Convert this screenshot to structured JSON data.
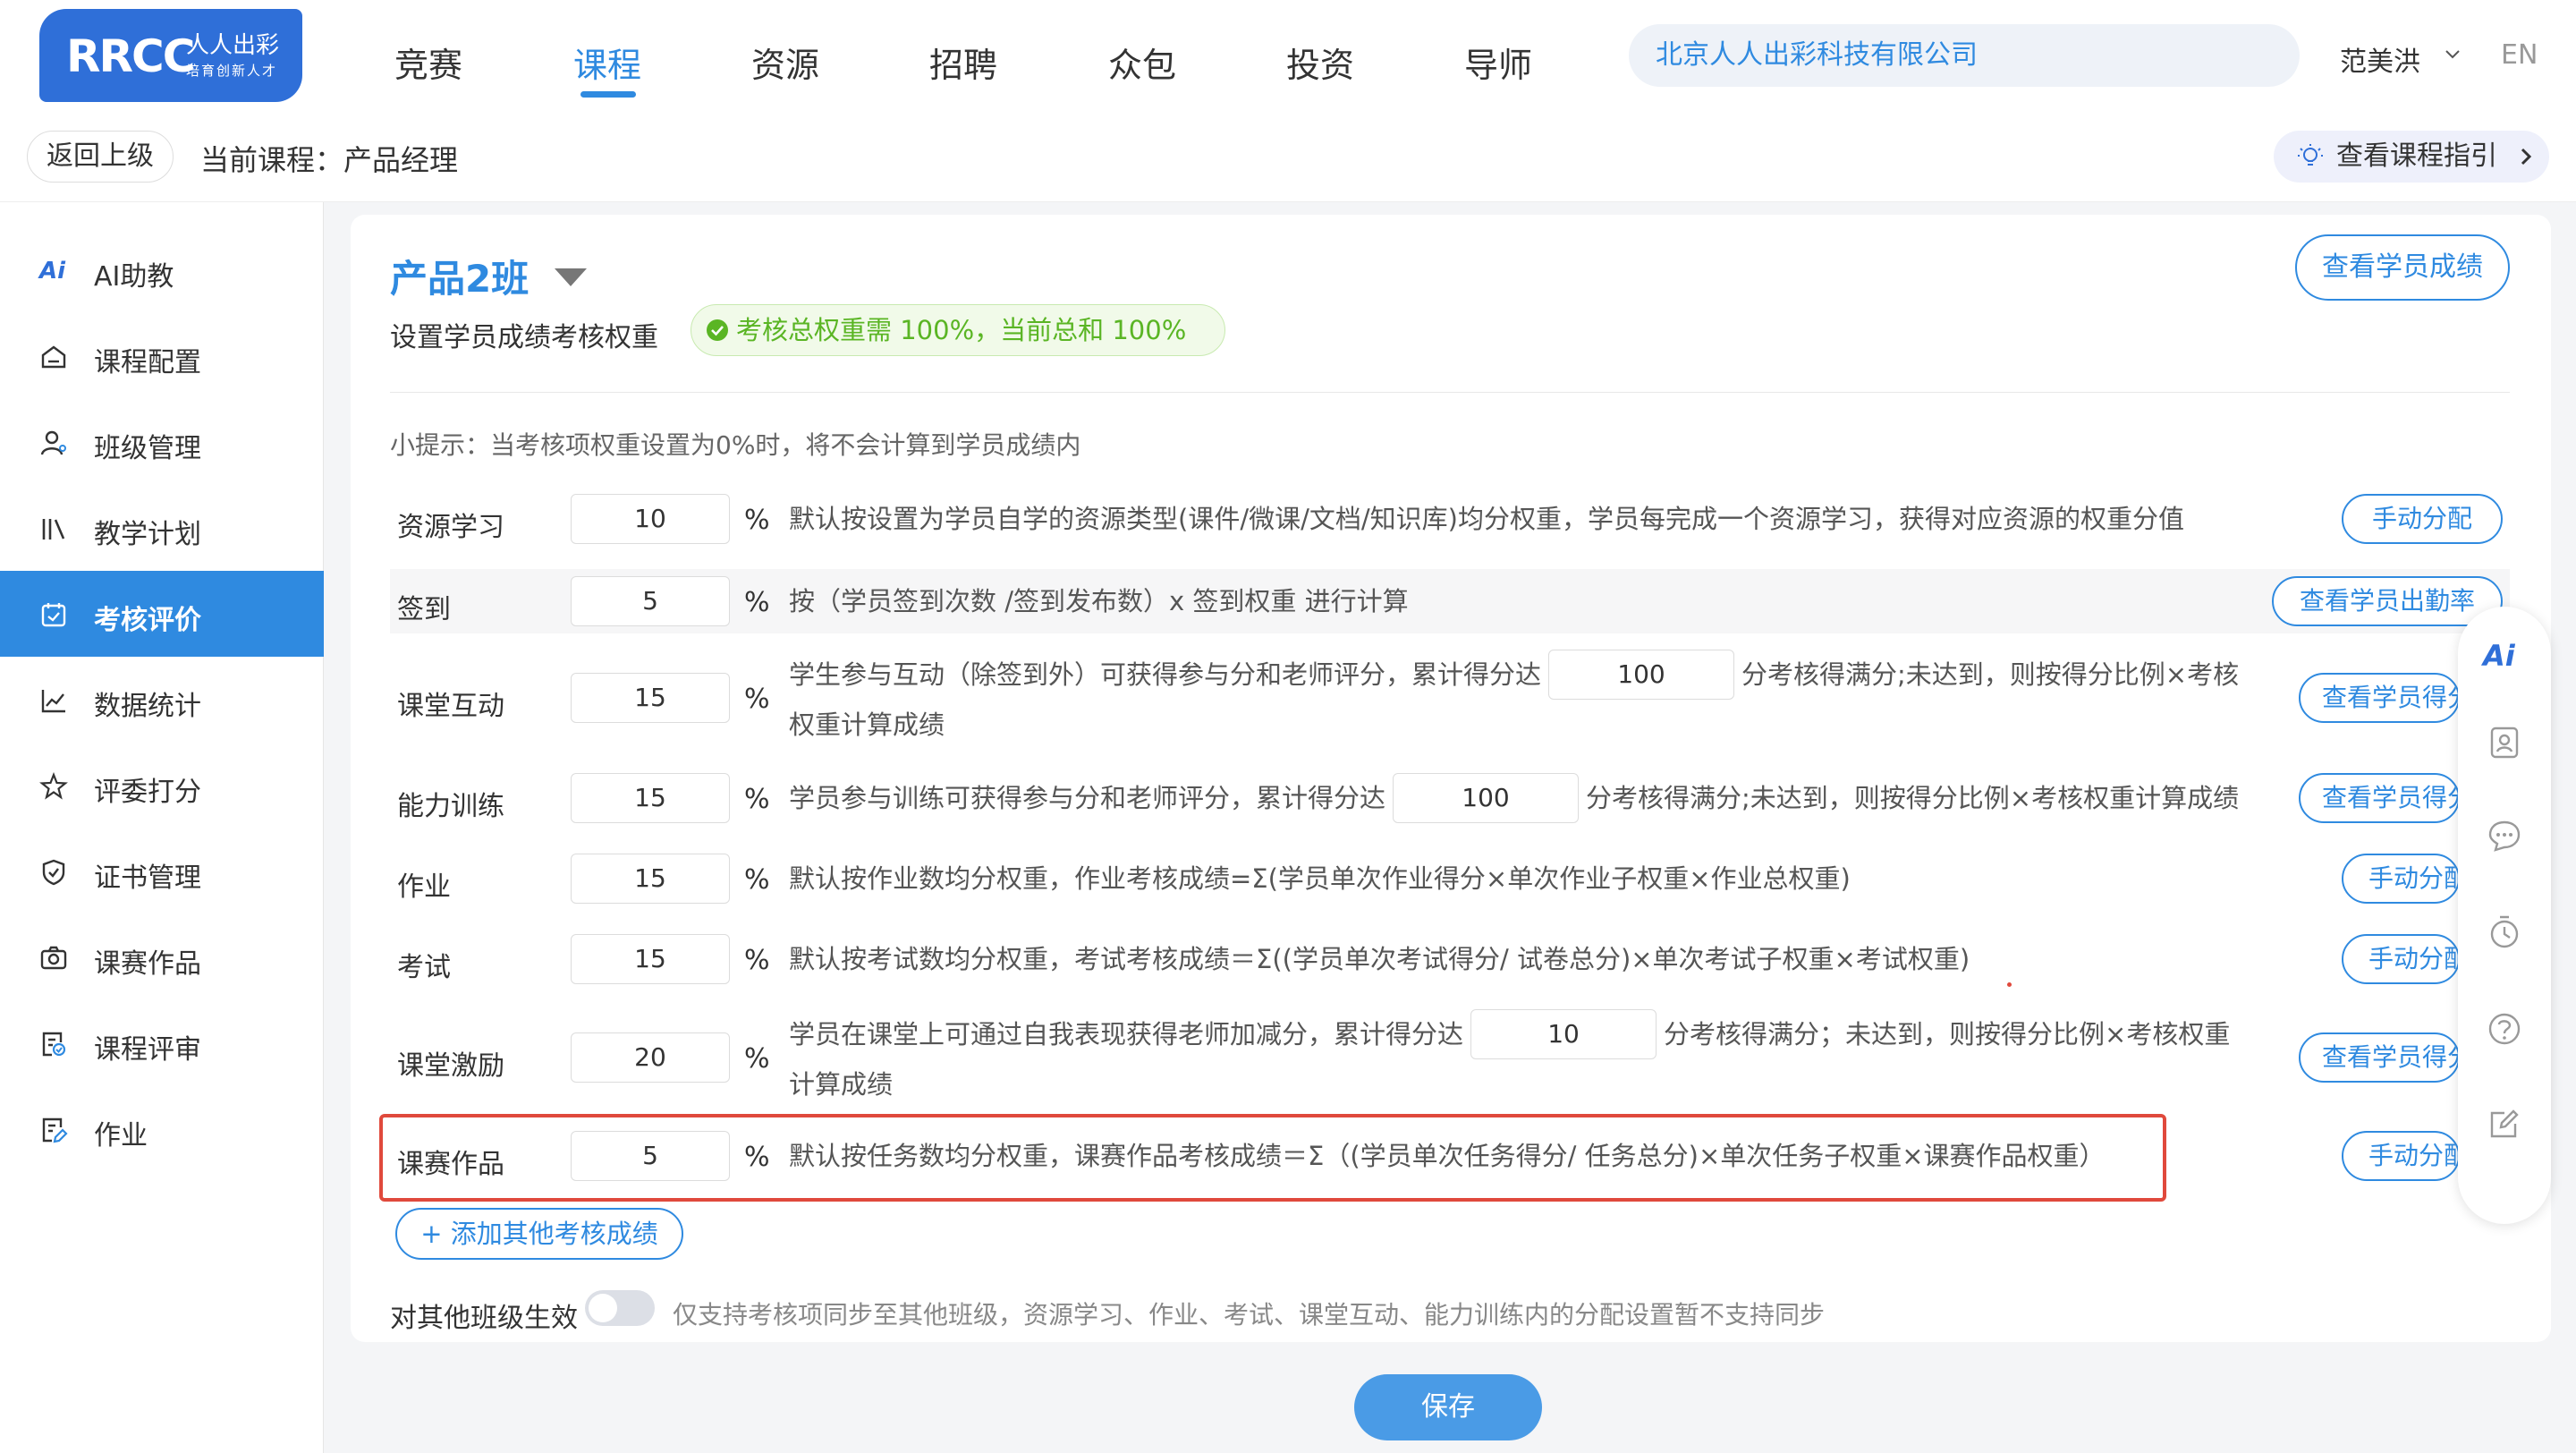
{
  "header": {
    "logo_text": "RRCC",
    "logo_cn": "人人出彩",
    "logo_slogan": "培育创新人才",
    "nav": [
      "竞赛",
      "课程",
      "资源",
      "招聘",
      "众包",
      "投资",
      "导师"
    ],
    "active_nav": "课程",
    "company": "北京人人出彩科技有限公司",
    "user": "范美洪",
    "lang": "EN"
  },
  "subbar": {
    "back": "返回上级",
    "current_course": "当前课程：产品经理",
    "guide": "查看课程指引"
  },
  "sidebar": {
    "items": [
      {
        "label": "AI助教",
        "icon": "ai-icon"
      },
      {
        "label": "课程配置",
        "icon": "home-icon"
      },
      {
        "label": "班级管理",
        "icon": "user-icon"
      },
      {
        "label": "教学计划",
        "icon": "books-icon"
      },
      {
        "label": "考核评价",
        "icon": "calendar-check-icon"
      },
      {
        "label": "数据统计",
        "icon": "line-chart-icon"
      },
      {
        "label": "评委打分",
        "icon": "star-icon"
      },
      {
        "label": "证书管理",
        "icon": "shield-icon"
      },
      {
        "label": "课赛作品",
        "icon": "camera-icon"
      },
      {
        "label": "课程评审",
        "icon": "review-icon"
      },
      {
        "label": "作业",
        "icon": "homework-icon"
      }
    ],
    "active": "考核评价"
  },
  "main": {
    "class_title": "产品2班",
    "view_scores": "查看学员成绩",
    "weight_label": "设置学员成绩考核权重",
    "weight_badge": "考核总权重需 100%，当前总和 100%",
    "tip": "小提示：当考核项权重设置为0%时，将不会计算到学员成绩内",
    "percent": "%",
    "rows": [
      {
        "name": "资源学习",
        "value": "10",
        "desc": "默认按设置为学员自学的资源类型(课件/微课/文档/知识库)均分权重，学员每完成一个资源学习，获得对应资源的权重分值",
        "button": "手动分配"
      },
      {
        "name": "签到",
        "value": "5",
        "desc": "按（学员签到次数 /签到发布数）x 签到权重 进行计算",
        "button": "查看学员出勤率"
      },
      {
        "name": "课堂互动",
        "value": "15",
        "desc_a": "学生参与互动（除签到外）可获得参与分和老师评分，累计得分达",
        "inline": "100",
        "desc_b": "分考核得满分;未达到，则按得分比例×考核",
        "desc_c": "权重计算成绩",
        "button": "查看学员得分"
      },
      {
        "name": "能力训练",
        "value": "15",
        "desc_a": "学员参与训练可获得参与分和老师评分，累计得分达",
        "inline": "100",
        "desc_b": "分考核得满分;未达到，则按得分比例×考核权重计算成绩",
        "button": "查看学员得分"
      },
      {
        "name": "作业",
        "value": "15",
        "desc": "默认按作业数均分权重，作业考核成绩=Σ(学员单次作业得分×单次作业子权重×作业总权重)",
        "button": "手动分配"
      },
      {
        "name": "考试",
        "value": "15",
        "desc": "默认按考试数均分权重，考试考核成绩＝Σ((学员单次考试得分/ 试卷总分)×单次考试子权重×考试权重)",
        "button": "手动分配"
      },
      {
        "name": "课堂激励",
        "value": "20",
        "desc_a": "学员在课堂上可通过自我表现获得老师加减分，累计得分达",
        "inline": "10",
        "desc_b": "分考核得满分；未达到，则按得分比例×考核权重",
        "desc_c": "计算成绩",
        "button": "查看学员得分"
      },
      {
        "name": "课赛作品",
        "value": "5",
        "desc": "默认按任务数均分权重，课赛作品考核成绩＝Σ（(学员单次任务得分/ 任务总分)×单次任务子权重×课赛作品权重）",
        "button": "手动分配"
      }
    ],
    "add_other": "+ 添加其他考核成绩",
    "sync_label": "对其他班级生效",
    "sync_hint": "仅支持考核项同步至其他班级，资源学习、作业、考试、课堂互动、能力训练内的分配设置暂不支持同步",
    "save": "保存"
  },
  "float_panel": {
    "ai_label": "Ai",
    "icons": [
      "ai-icon",
      "contact-card-icon",
      "chat-icon",
      "timer-icon",
      "help-icon",
      "edit-icon"
    ]
  }
}
